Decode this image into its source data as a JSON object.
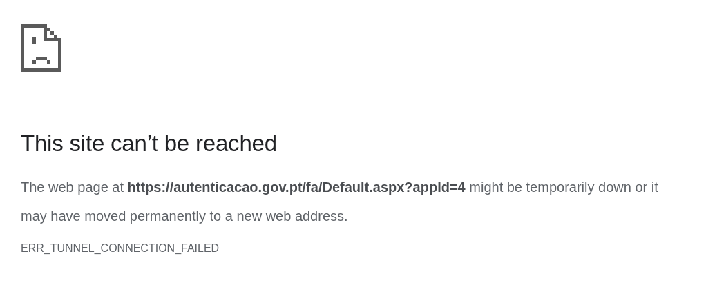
{
  "error_page": {
    "title": "This site can’t be reached",
    "message": "The web page at **https://autenticacao.gov.pt/fa/Default.aspx?appId=4** might be temporarily down or it may have moved permanently to a new web address.",
    "error_code": "ERR_TUNNEL_CONNECTION_FAILED"
  }
}
